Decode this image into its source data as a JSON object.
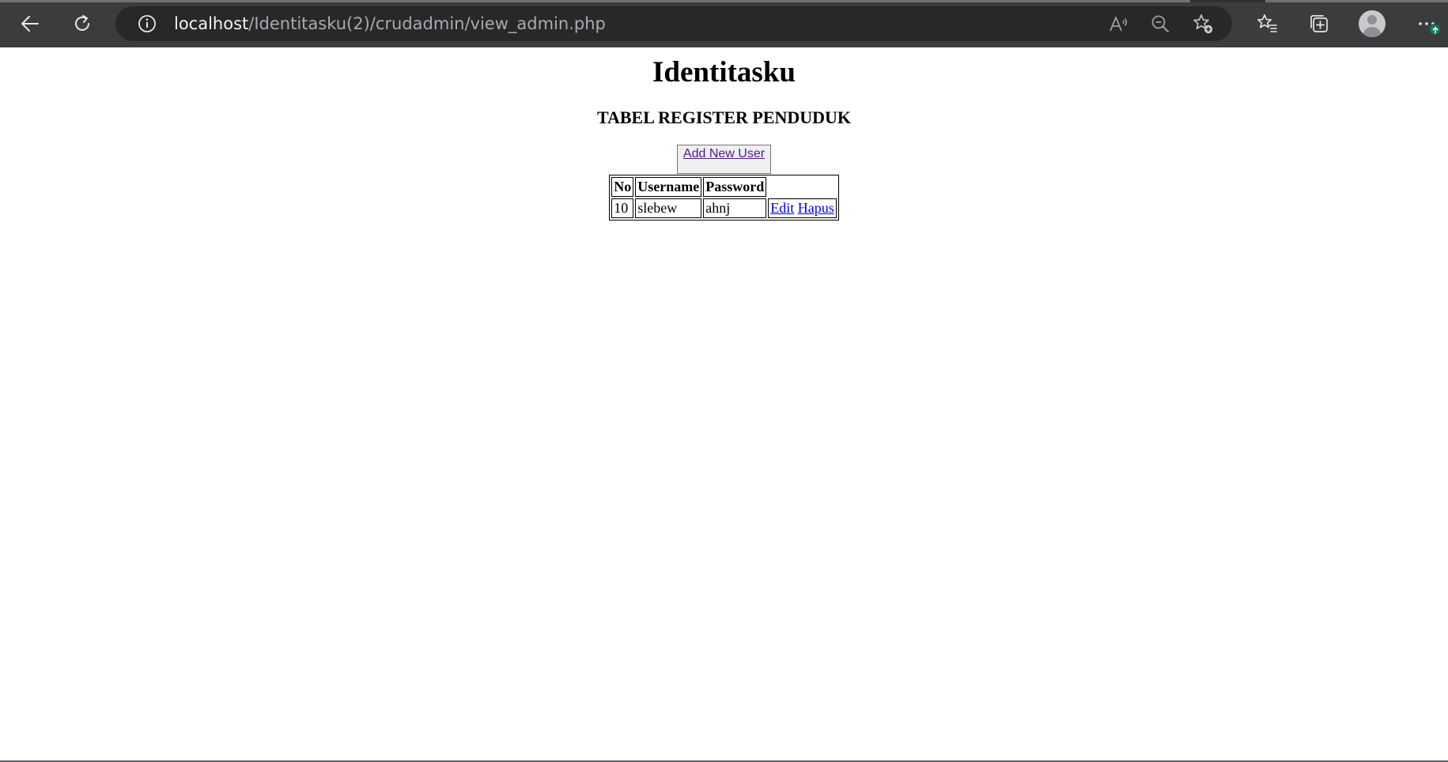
{
  "browser": {
    "url_host": "localhost",
    "url_path": "/Identitasku(2)/crudadmin/view_admin.php",
    "icons": [
      "back-icon",
      "refresh-icon",
      "site-info-icon",
      "read-aloud-icon",
      "zoom-out-icon",
      "add-favorite-icon",
      "favorites-icon",
      "collections-icon",
      "profile-avatar",
      "more-icon",
      "update-available-icon"
    ]
  },
  "page": {
    "heading": "Identitasku",
    "subheading": "TABEL REGISTER PENDUDUK",
    "add_button_label": "Add New User"
  },
  "table": {
    "headers": [
      "No",
      "Username",
      "Password",
      ""
    ],
    "rows": [
      {
        "no": "10",
        "username": "slebew",
        "password": "ahnj",
        "edit_label": "Edit",
        "delete_label": "Hapus"
      }
    ]
  },
  "colors": {
    "toolbar_bg": "#3b3c3e",
    "urlbar_bg": "#27282a",
    "link": "#0000ee",
    "visited_link": "#551a8b"
  }
}
